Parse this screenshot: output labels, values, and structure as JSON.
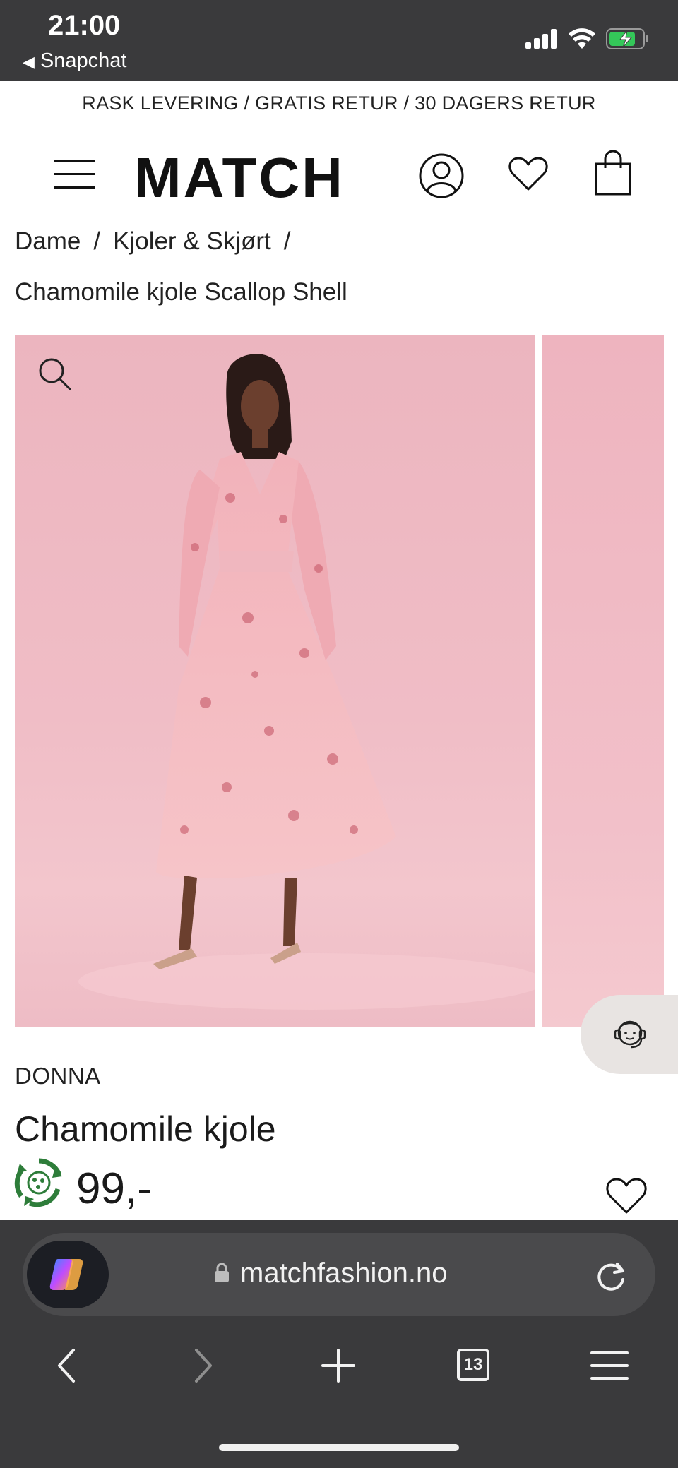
{
  "status_bar": {
    "time": "21:00",
    "back_app": "Snapchat",
    "icons": [
      "cellular-signal-icon",
      "wifi-icon",
      "battery-charging-icon"
    ],
    "battery_color": "#34c759"
  },
  "promo": {
    "text": "RASK LEVERING / GRATIS RETUR / 30 DAGERS RETUR"
  },
  "header": {
    "logo": "MATCH",
    "icons": [
      "menu-icon",
      "account-icon",
      "wishlist-icon",
      "shopping-bag-icon"
    ]
  },
  "breadcrumb": {
    "items": [
      "Dame",
      "Kjoler & Skjørt"
    ],
    "separator": "/",
    "current": "Chamomile kjole Scallop Shell"
  },
  "gallery": {
    "zoom_icon": "search-icon",
    "background_color": "#f0bcc6"
  },
  "support": {
    "icon": "customer-support-icon"
  },
  "product": {
    "brand": "DONNA",
    "name": "Chamomile kjole",
    "price": "99,-",
    "badge_icon": "recycle-badge-icon",
    "badge_color": "#2e7d3a",
    "wishlist_icon": "heart-icon"
  },
  "browser": {
    "url": "matchfashion.no",
    "tab_count": "13",
    "assistant_icon": "copilot-icon",
    "toolbar": [
      "back-icon",
      "forward-icon",
      "new-tab-icon",
      "tabs-icon",
      "menu-icon"
    ]
  }
}
